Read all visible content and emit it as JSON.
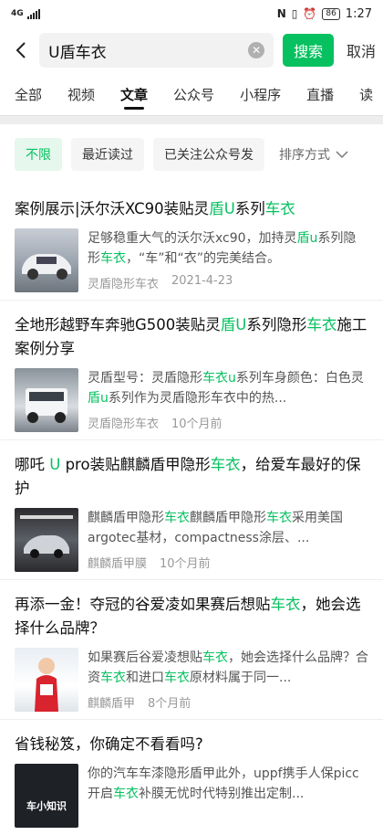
{
  "status": {
    "left_text": "4G",
    "time": "1:27",
    "battery": "86",
    "icons": [
      "nfc-icon",
      "vibrate-icon",
      "alarm-icon",
      "battery-icon"
    ]
  },
  "search": {
    "query": "U盾车衣",
    "button": "搜索",
    "cancel": "取消"
  },
  "tabs": [
    "全部",
    "视频",
    "文章",
    "公众号",
    "小程序",
    "直播",
    "读"
  ],
  "filters": {
    "chips": [
      "不限",
      "最近读过",
      "已关注公众号发"
    ],
    "sort": "排序方式"
  },
  "accent": "#07c160",
  "articles": [
    {
      "title_parts": [
        "案例展示|沃尔沃XC90装贴灵",
        "盾U",
        "系列",
        "车衣"
      ],
      "desc_parts": [
        "足够稳重大气的沃尔沃xc90，加持灵",
        "盾u",
        "系列隐形",
        "车衣",
        "，“车”和“衣”的完美结合。"
      ],
      "source": "灵盾隐形车衣",
      "time": "2021-4-23"
    },
    {
      "title_parts": [
        "全地形越野车奔驰G500装贴灵",
        "盾U",
        "系列隐形",
        "车衣",
        "施工案例分享"
      ],
      "desc_parts": [
        "灵盾型号：灵盾隐形",
        "车衣u",
        "系列车身颜色：白色灵",
        "盾u",
        "系列作为灵盾隐形车衣中的热..."
      ],
      "source": "灵盾隐形车衣",
      "time": "10个月前"
    },
    {
      "title_parts": [
        "哪吒 ",
        "U",
        " pro装贴麒麟盾甲隐形",
        "车衣",
        "，给爱车最好的保护"
      ],
      "desc_parts": [
        "麒麟盾甲隐形",
        "车衣",
        "麒麟盾甲隐形",
        "车衣",
        "采用美国argotec基材，compactness涂层、..."
      ],
      "source": "麒麟盾甲膜",
      "time": "10个月前"
    },
    {
      "title_parts": [
        "再添一金！夺冠的谷爱凌如果赛后想贴",
        "车衣",
        "，她会选择什么品牌？"
      ],
      "desc_parts": [
        "如果赛后谷爱凌想贴",
        "车衣",
        "，她会选择什么品牌？合资",
        "车衣",
        "和进口",
        "车衣",
        "原材料属于同一..."
      ],
      "source": "麒麟盾甲",
      "time": "8个月前"
    },
    {
      "title_parts": [
        "省钱秘笈，你确定不看看吗?"
      ],
      "desc_parts": [
        "你的汽车车漆隐形盾甲此外，uppf携手人保picc开启",
        "车衣",
        "补膜无忧时代特别推出定制..."
      ],
      "source": "",
      "time": "",
      "thumb_text": "车小知识"
    }
  ]
}
